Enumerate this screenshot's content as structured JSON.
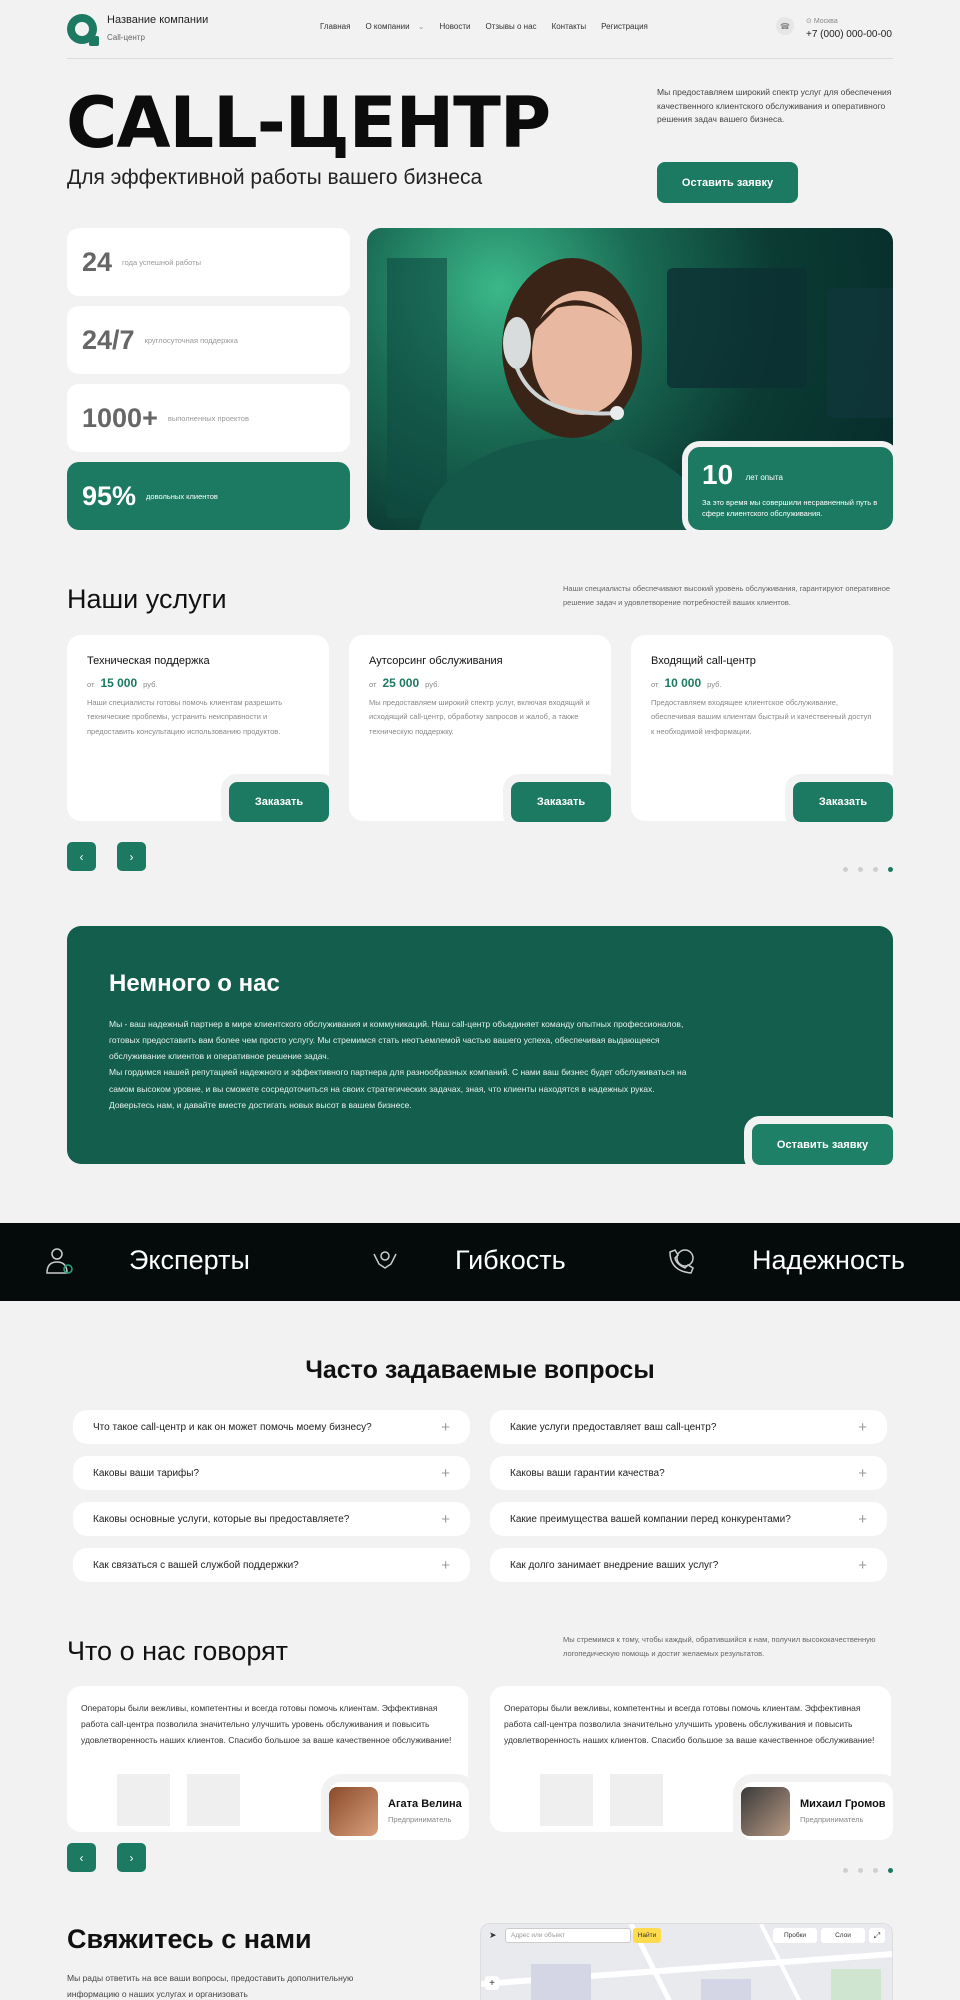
{
  "header": {
    "company_name": "Название компании",
    "company_sub": "Call-центр",
    "nav": [
      "Главная",
      "О компании",
      "Новости",
      "Отзывы о нас",
      "Контакты",
      "Регистрация"
    ],
    "city": "Москва",
    "phone": "+7 (000) 000-00-00"
  },
  "hero": {
    "title": "CALL-ЦЕНТР",
    "subtitle": "Для эффективной работы вашего бизнеса",
    "description": "Мы предоставляем широкий спектр услуг для обеспечения качественного клиентского обслуживания и оперативного решения задач вашего бизнеса.",
    "cta": "Оставить заявку"
  },
  "stats": [
    {
      "value": "24",
      "label": "года успешной работы"
    },
    {
      "value": "24/7",
      "label": "круглосуточная поддержка"
    },
    {
      "value": "1000+",
      "label": "выполненных проектов"
    },
    {
      "value": "95%",
      "label": "довольных клиентов"
    }
  ],
  "experience": {
    "value": "10",
    "label": "лет опыта",
    "description": "За это время мы совершили несравненный путь в сфере клиентского обслуживания."
  },
  "services": {
    "title": "Наши услуги",
    "description": "Наши специалисты обеспечивают высокий уровень обслуживания, гарантируют оперативное решение задач и удовлетворение потребностей ваших клиентов.",
    "items": [
      {
        "title": "Техническая поддержка",
        "from": "от",
        "price": "15 000",
        "currency": "руб.",
        "text": "Наши специалисты готовы помочь клиентам разрешить технические проблемы, устранить неисправности и предоставить консультацию использованию продуктов.",
        "button": "Заказать"
      },
      {
        "title": "Аутсорсинг обслуживания",
        "from": "от",
        "price": "25 000",
        "currency": "руб.",
        "text": "Мы предоставляем широкий спектр услуг, включая входящий и исходящий call-центр, обработку запросов и жалоб, а также техническую поддержку.",
        "button": "Заказать"
      },
      {
        "title": "Входящий call-центр",
        "from": "от",
        "price": "10 000",
        "currency": "руб.",
        "text": "Предоставляем входящее клиентское обслуживание, обеспечивая вашим клиентам быстрый и качественный доступ к необходимой информации.",
        "button": "Заказать"
      }
    ]
  },
  "about": {
    "title": "Немного о нас",
    "p1": "Мы - ваш надежный партнер в мире клиентского обслуживания и коммуникаций. Наш call-центр объединяет команду опытных профессионалов, готовых предоставить вам более чем просто услугу. Мы стремимся стать неотъемлемой частью вашего успеха, обеспечивая выдающееся обслуживание клиентов и оперативное решение задач.",
    "p2": "Мы гордимся нашей репутацией надежного и эффективного партнера для разнообразных компаний. С нами ваш бизнес будет обслуживаться на самом высоком уровне, и вы сможете сосредоточиться на своих стратегических задачах, зная, что клиенты находятся в надежных руках. Доверьтесь нам, и давайте вместе достигать новых высот в вашем бизнесе.",
    "cta": "Оставить заявку"
  },
  "band": [
    "Эксперты",
    "Гибкость",
    "Надежность"
  ],
  "faq": {
    "title": "Часто задаваемые вопросы",
    "left": [
      "Что такое call-центр и как он может помочь моему бизнесу?",
      "Каковы ваши тарифы?",
      "Каковы основные услуги, которые вы предоставляете?",
      "Как связаться с вашей службой поддержки?"
    ],
    "right": [
      "Какие услуги предоставляет ваш call-центр?",
      "Каковы ваши гарантии качества?",
      "Какие преимущества вашей компании перед конкурентами?",
      "Как долго занимает внедрение ваших услуг?"
    ]
  },
  "testimonials": {
    "title": "Что о нас говорят",
    "description": "Мы стремимся к тому, чтобы каждый, обратившийся к нам, получил высококачественную логопедическую помощь и достиг желаемых результатов.",
    "items": [
      {
        "text": "Операторы были вежливы, компетентны и всегда готовы помочь клиентам. Эффективная работа call-центра позволила значительно улучшить уровень обслуживания и повысить удовлетворенность наших клиентов. Спасибо большое за ваше качественное обслуживание!",
        "name": "Агата Велина",
        "role": "Предприниматель"
      },
      {
        "text": "Операторы были вежливы, компетентны и всегда готовы помочь клиентам. Эффективная работа call-центра позволила значительно улучшить уровень обслуживания и повысить удовлетворенность наших клиентов. Спасибо большое за ваше качественное обслуживание!",
        "name": "Михаил Громов",
        "role": "Предприниматель"
      }
    ]
  },
  "contact": {
    "title": "Свяжитесь с нами",
    "description": "Мы рады ответить на все ваши вопросы, предоставить дополнительную информацию о наших услугах и организовать",
    "map_search_placeholder": "Адрес или объект",
    "map_search_button": "Найти",
    "map_traffic": "Пробки",
    "map_layers": "Слои"
  },
  "icons": {
    "expert": "expert-icon",
    "flex": "flex-icon",
    "reliable": "globe-phone-icon"
  },
  "colors": {
    "accent": "#1d7a62",
    "about_bg": "#135e4c",
    "band_bg": "#050b0a"
  }
}
